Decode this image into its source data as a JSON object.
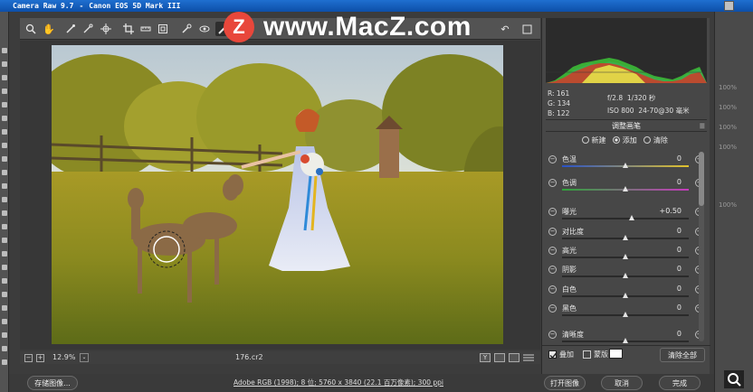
{
  "window": {
    "title_app": "Camera Raw 9.7",
    "title_camera": "Canon EOS 5D Mark III"
  },
  "watermark": {
    "logo_letter": "Z",
    "text": "www.MacZ.com"
  },
  "toolbar": {
    "tools": [
      "zoom-icon",
      "hand-icon",
      "white-balance-icon",
      "color-sampler-icon",
      "target-adjust-icon",
      "crop-icon",
      "straighten-icon",
      "transform-icon",
      "spot-removal-icon",
      "red-eye-icon",
      "adjustment-brush-icon",
      "graduated-filter-icon",
      "radial-filter-icon",
      "preferences-icon",
      "rotate-left-icon",
      "rotate-right-icon"
    ],
    "fullscreen_icon": "fullscreen-icon"
  },
  "readout": {
    "r_label": "R:",
    "r_value": "161",
    "g_label": "G:",
    "g_value": "134",
    "b_label": "B:",
    "b_value": "122",
    "aperture": "f/2.8",
    "shutter": "1/320 秒",
    "iso": "ISO 800",
    "lens": "24-70@30 毫米"
  },
  "panel": {
    "title": "调整画笔",
    "mode_new": "新建",
    "mode_add": "添加",
    "mode_clear": "清除",
    "selected_mode": "添加"
  },
  "sliders": [
    {
      "label": "色温",
      "value": "0",
      "level": 0.5
    },
    {
      "label": "色调",
      "value": "0",
      "level": 0.5
    },
    {
      "label": "曝光",
      "value": "+0.50",
      "level": 0.55
    },
    {
      "label": "对比度",
      "value": "0",
      "level": 0.5
    },
    {
      "label": "高光",
      "value": "0",
      "level": 0.5
    },
    {
      "label": "阴影",
      "value": "0",
      "level": 0.5
    },
    {
      "label": "白色",
      "value": "0",
      "level": 0.5
    },
    {
      "label": "黑色",
      "value": "0",
      "level": 0.5
    },
    {
      "label": "清晰度",
      "value": "0",
      "level": 0.5
    }
  ],
  "panel_bottom": {
    "overlay_label": "叠加",
    "overlay_checked": true,
    "mask_label": "蒙版",
    "mask_checked": false,
    "clear_all": "清除全部"
  },
  "status": {
    "zoom": "12.9%",
    "filename": "176.cr2"
  },
  "bottom": {
    "save_image": "存储图像...",
    "workflow_link": "Adobe RGB (1998); 8 位; 5760 x 3840 (22.1 百万像素); 300 ppi",
    "open_image": "打开图像",
    "cancel": "取消",
    "done": "完成"
  },
  "ps_right": {
    "zoom_rows": [
      "100%",
      "100%",
      "100%",
      "100%",
      "100%"
    ]
  }
}
